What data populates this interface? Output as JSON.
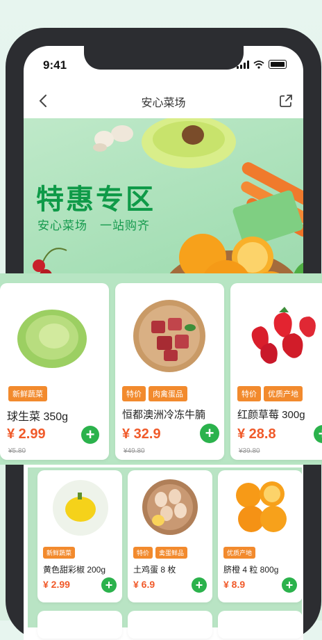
{
  "status": {
    "time": "9:41"
  },
  "navbar": {
    "title": "安心菜场"
  },
  "banner": {
    "title": "特惠专区",
    "subtitle": "安心菜场　一站购齐",
    "accent_color": "#0f9a48"
  },
  "row1": [
    {
      "badges": [
        "新鲜蔬菜"
      ],
      "name": "球生菜 350g",
      "price": "¥ 2.99",
      "orig": "¥5.80"
    },
    {
      "badges": [
        "特价",
        "肉禽蛋品"
      ],
      "name": "恒都澳洲冷冻牛腩",
      "price": "¥ 32.9",
      "orig": "¥49.80"
    },
    {
      "badges": [
        "特价",
        "优质产地"
      ],
      "name": "红颜草莓 300g",
      "price": "¥ 28.8",
      "orig": "¥39.80"
    }
  ],
  "row2": [
    {
      "badges": [
        "新鲜蔬菜"
      ],
      "name": "黄色甜彩椒 200g",
      "price": "¥ 2.99"
    },
    {
      "badges": [
        "特价",
        "禽蛋鲜品"
      ],
      "name": "土鸡蛋 8 枚",
      "price": "¥ 6.9"
    },
    {
      "badges": [
        "优质产地"
      ],
      "name": "脐橙 4 粒 800g",
      "price": "¥ 8.9"
    }
  ],
  "icons": {
    "back": "chevron-left-icon",
    "share": "share-icon",
    "add": "plus-icon"
  }
}
